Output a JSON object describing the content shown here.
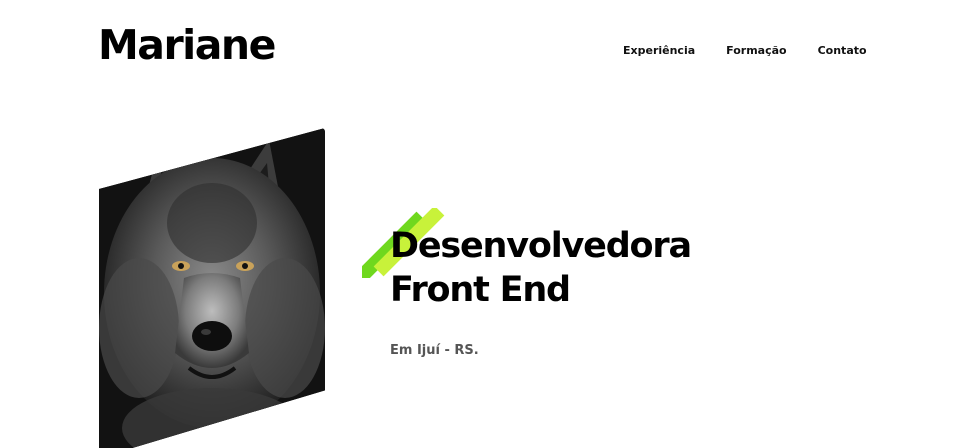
{
  "header": {
    "logo": "Mariane",
    "nav": [
      {
        "label": "Experiência"
      },
      {
        "label": "Formação"
      },
      {
        "label": "Contato"
      }
    ]
  },
  "hero": {
    "title_line1": "Desenvolvedora",
    "title_line2": "Front End",
    "location": "Em Ijuí - RS.",
    "photo_subject": "wolf-portrait",
    "accent_colors": [
      "#6fd81e",
      "#c8f23a"
    ]
  }
}
